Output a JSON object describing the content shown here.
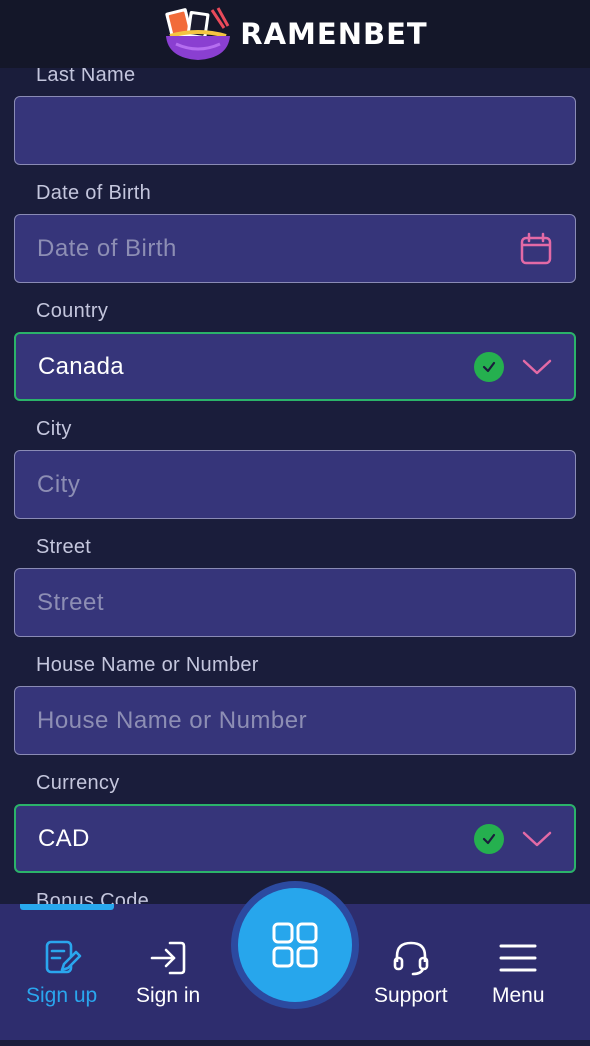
{
  "header": {
    "logo_text": "RAMENBET"
  },
  "form": {
    "last_name": {
      "label": "Last Name",
      "value": ""
    },
    "dob": {
      "label": "Date of Birth",
      "placeholder": "Date of Birth"
    },
    "country": {
      "label": "Country",
      "value": "Canada"
    },
    "city": {
      "label": "City",
      "placeholder": "City"
    },
    "street": {
      "label": "Street",
      "placeholder": "Street"
    },
    "house": {
      "label": "House Name or Number",
      "placeholder": "House Name or Number"
    },
    "currency": {
      "label": "Currency",
      "value": "CAD"
    },
    "bonus_code": {
      "label": "Bonus Code"
    }
  },
  "nav": {
    "signup": "Sign up",
    "signin": "Sign in",
    "support": "Support",
    "menu": "Menu"
  },
  "colors": {
    "accent": "#28a8ee",
    "valid": "#2bb36a",
    "field_bg": "#36357a",
    "calendar_icon": "#e36aa6"
  }
}
